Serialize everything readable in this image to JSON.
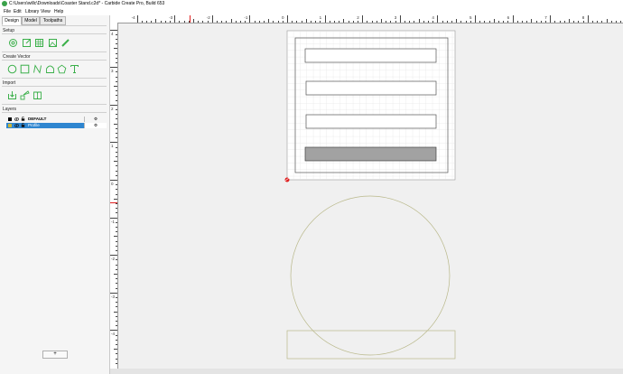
{
  "window": {
    "title": "C:\\Users\\willc\\Downloads\\Coaster Stand.c2d* - Carbide Create Pro, Build 653"
  },
  "menu": {
    "items": [
      "File",
      "Edit",
      "Library",
      "View",
      "Help"
    ]
  },
  "panel": {
    "tabs": [
      "Design",
      "Model",
      "Toolpaths"
    ],
    "active_tab": "Design",
    "setup_label": "Setup",
    "create_vector_label": "Create Vector",
    "import_label": "Import",
    "layers_label": "Layers",
    "setup_tools": [
      "job-setup-icon",
      "edit-icon",
      "grid-icon",
      "image-icon",
      "measure-icon"
    ],
    "vector_tools": [
      "circle-icon",
      "rectangle-icon",
      "curve-icon",
      "polygon-icon",
      "pentagon-icon",
      "text-icon"
    ],
    "import_tools": [
      "import-icon",
      "import-svg-icon",
      "import-stl-icon"
    ],
    "layers": [
      {
        "name": "DEFAULT",
        "color": "#000000",
        "selected": false
      },
      {
        "name": "Profile",
        "color": "#c8b43a",
        "selected": true
      }
    ],
    "add_layer_label": "+"
  },
  "ruler": {
    "h_labels": [
      "-4",
      "-3",
      "-2",
      "-1",
      "0",
      "1",
      "2",
      "3",
      "4",
      "5",
      "6",
      "7",
      "8"
    ],
    "v_labels": [
      "4",
      "3",
      "2",
      "1",
      "0",
      "-1",
      "-2",
      "-3",
      "-4"
    ]
  },
  "colors": {
    "accent": "#2f86d0",
    "vector_stroke": "#555555",
    "profile_stroke": "#b9b88a",
    "origin": "#e02020"
  }
}
